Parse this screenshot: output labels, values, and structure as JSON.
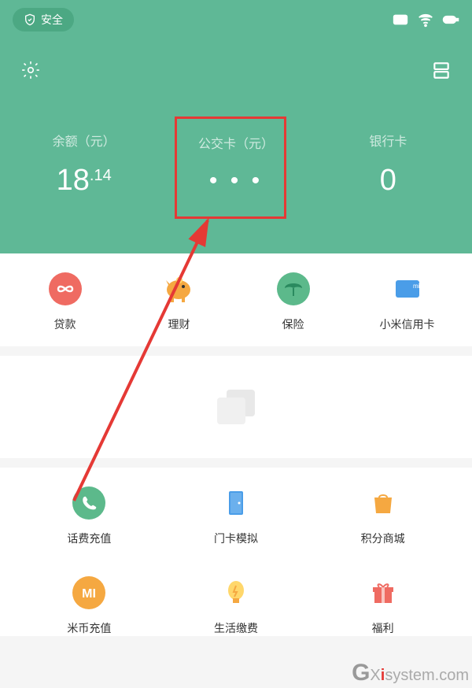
{
  "status": {
    "safe_label": "安全"
  },
  "balances": [
    {
      "label": "余额（元）",
      "whole": "18",
      "cents": ".14"
    },
    {
      "label": "公交卡（元）",
      "value": "• • •"
    },
    {
      "label": "银行卡",
      "value": "0"
    }
  ],
  "row1": [
    {
      "label": "贷款"
    },
    {
      "label": "理财"
    },
    {
      "label": "保险"
    },
    {
      "label": "小米信用卡"
    }
  ],
  "row2": [
    {
      "label": "话费充值"
    },
    {
      "label": "门卡模拟"
    },
    {
      "label": "积分商城"
    }
  ],
  "row3": [
    {
      "label": "米币充值"
    },
    {
      "label": "生活缴费"
    },
    {
      "label": "福利"
    }
  ],
  "watermark": {
    "part1": "X",
    "part2": "i",
    "part3": "system.com"
  }
}
